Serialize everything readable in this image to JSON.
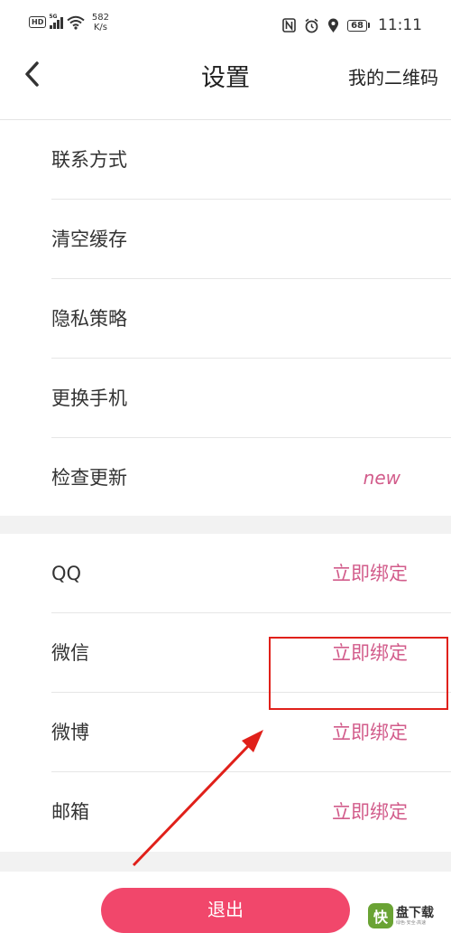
{
  "status_bar": {
    "badge": "HD",
    "network": "5G",
    "speed_value": "582",
    "speed_unit": "K/s",
    "battery": "68",
    "time": "11:11"
  },
  "header": {
    "title": "设置",
    "qr_label": "我的二维码"
  },
  "general_items": [
    {
      "label": "联系方式"
    },
    {
      "label": "清空缓存"
    },
    {
      "label": "隐私策略"
    },
    {
      "label": "更换手机"
    },
    {
      "label": "检查更新",
      "tag": "new"
    }
  ],
  "bind_items": [
    {
      "label": "QQ",
      "action": "立即绑定"
    },
    {
      "label": "微信",
      "action": "立即绑定"
    },
    {
      "label": "微博",
      "action": "立即绑定"
    },
    {
      "label": "邮箱",
      "action": "立即绑定"
    }
  ],
  "logout_label": "退出",
  "watermark": {
    "logo_char": "快",
    "name": "盘下载",
    "sub": "绿色·安全·高速"
  },
  "colors": {
    "accent": "#d25c8b",
    "logout_bg": "#f1476b",
    "annotation_red": "#e0201a",
    "section_gap": "#f2f2f2"
  }
}
